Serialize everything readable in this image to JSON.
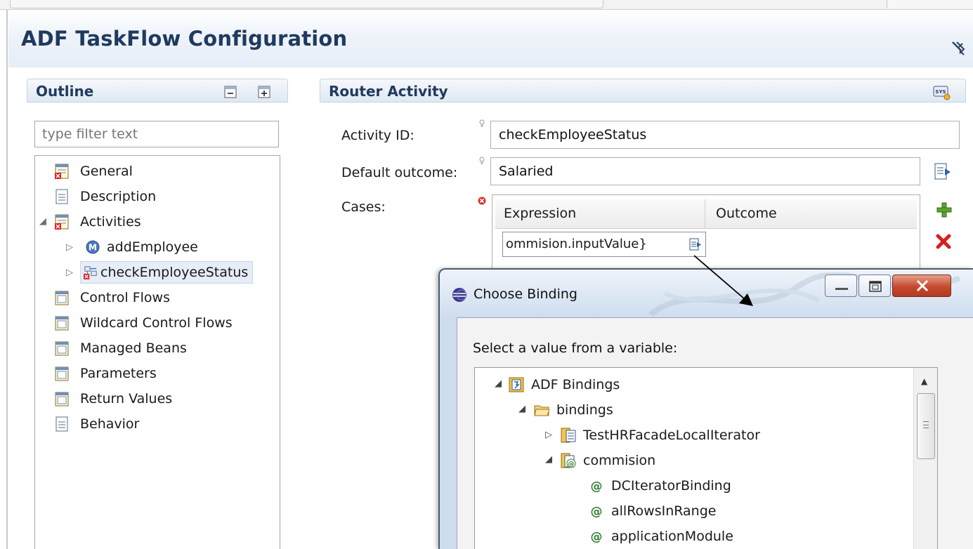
{
  "header": {
    "title": "ADF TaskFlow Configuration"
  },
  "outline": {
    "title": "Outline",
    "filter_placeholder": "type filter text",
    "items": [
      {
        "label": "General"
      },
      {
        "label": "Description"
      },
      {
        "label": "Activities"
      },
      {
        "label": "addEmployee"
      },
      {
        "label": "checkEmployeeStatus"
      },
      {
        "label": "Control Flows"
      },
      {
        "label": "Wildcard Control Flows"
      },
      {
        "label": "Managed Beans"
      },
      {
        "label": "Parameters"
      },
      {
        "label": "Return Values"
      },
      {
        "label": "Behavior"
      }
    ]
  },
  "router": {
    "title": "Router Activity",
    "activity_id_label": "Activity ID:",
    "activity_id_value": "checkEmployeeStatus",
    "default_outcome_label": "Default outcome:",
    "default_outcome_value": "Salaried",
    "cases_label": "Cases:",
    "cases_columns": [
      "Expression",
      "Outcome"
    ],
    "cases_row_expression": "ommision.inputValue}"
  },
  "dialog": {
    "title": "Choose Binding",
    "prompt": "Select a value from a variable:",
    "tree": [
      {
        "label": "ADF Bindings"
      },
      {
        "label": "bindings"
      },
      {
        "label": "TestHRFacadeLocalIterator"
      },
      {
        "label": "commision"
      },
      {
        "label": "DCIteratorBinding"
      },
      {
        "label": "allRowsInRange"
      },
      {
        "label": "applicationModule"
      }
    ]
  },
  "colors": {
    "title_blue": "#1f3a5f",
    "selection": "#e6edf7",
    "close_red": "#c44a2e"
  },
  "icons": [
    "pin-icon",
    "collapse-all-icon",
    "expand-all-icon",
    "help-icon",
    "page-icon",
    "page-error-icon",
    "method-icon",
    "router-icon",
    "lightbulb-icon",
    "error-icon",
    "picker-icon",
    "add-icon",
    "delete-icon",
    "eclipse-icon",
    "minimize-icon",
    "maximize-icon",
    "close-icon",
    "bindings-icon",
    "folder-icon",
    "iterator-icon",
    "attribute-icon"
  ]
}
